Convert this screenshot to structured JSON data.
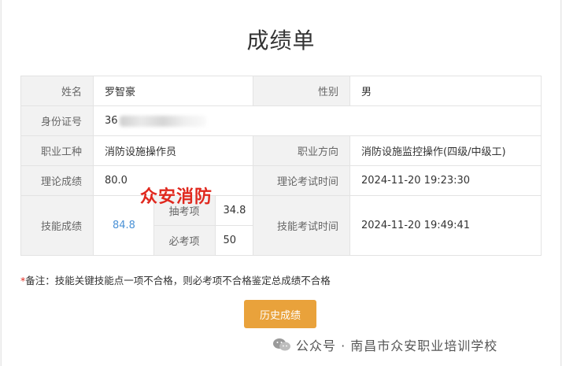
{
  "title": "成绩单",
  "fields": {
    "name_label": "姓名",
    "name_value": "罗智豪",
    "gender_label": "性别",
    "gender_value": "男",
    "id_label": "身份证号",
    "id_value_visible": "36",
    "occupation_label": "职业工种",
    "occupation_value": "消防设施操作员",
    "direction_label": "职业方向",
    "direction_value": "消防设施监控操作(四级/中级工)",
    "theory_label": "理论成绩",
    "theory_value": "80.0",
    "theory_time_label": "理论考试时间",
    "theory_time_value": "2024-11-20 19:23:30",
    "skill_label": "技能成绩",
    "skill_value": "84.8",
    "sampled_label": "抽考项",
    "sampled_value": "34.8",
    "required_label": "必考项",
    "required_value": "50",
    "skill_time_label": "技能考试时间",
    "skill_time_value": "2024-11-20 19:49:41"
  },
  "stamp_text": "众安消防",
  "note": {
    "star": "*",
    "text": "备注：技能关键技能点一项不合格，则必考项不合格鉴定总成绩不合格"
  },
  "history_button_label": "历史成绩",
  "watermark": {
    "icon": "wechat-icon",
    "text": "公众号 · 南昌市众安职业培训学校"
  },
  "colors": {
    "label_bg": "#f2f2f2",
    "skill_score": "#4b92d6",
    "button": "#e9a23b",
    "stamp": "#e0281e"
  }
}
